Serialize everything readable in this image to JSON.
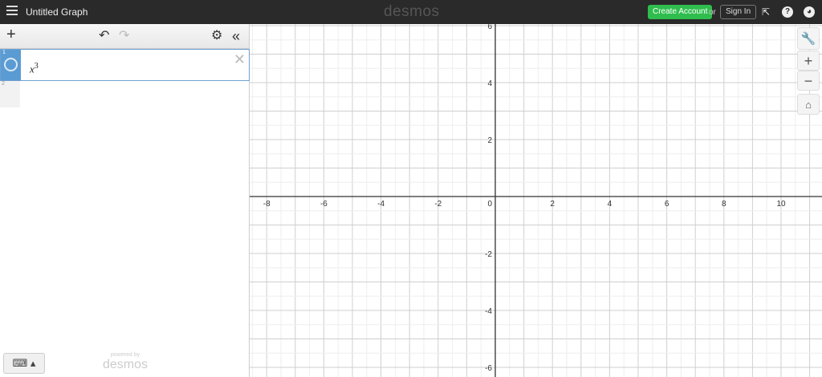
{
  "topbar": {
    "title": "Untitled Graph",
    "logo": "desmos",
    "create_account": "Create Account",
    "or": "or",
    "sign_in": "Sign In"
  },
  "panel": {
    "expressions": [
      {
        "index": "1",
        "latex_base": "x",
        "latex_sup": "3"
      },
      {
        "index": "2"
      }
    ],
    "powered_by": "powered by",
    "powered_logo": "desmos"
  },
  "graph": {
    "x_ticks": [
      "-8",
      "-6",
      "-4",
      "-2",
      "2",
      "4",
      "6",
      "8",
      "10"
    ],
    "x_tick_values": [
      -8,
      -6,
      -4,
      -2,
      2,
      4,
      6,
      8,
      10
    ],
    "y_ticks": [
      "6",
      "4",
      "2",
      "-2",
      "-4",
      "-6"
    ],
    "y_tick_values": [
      6,
      4,
      2,
      -2,
      -4,
      -6
    ],
    "origin_label": "0"
  },
  "colors": {
    "accent": "#5b9bd3",
    "create": "#2fbd4e"
  }
}
